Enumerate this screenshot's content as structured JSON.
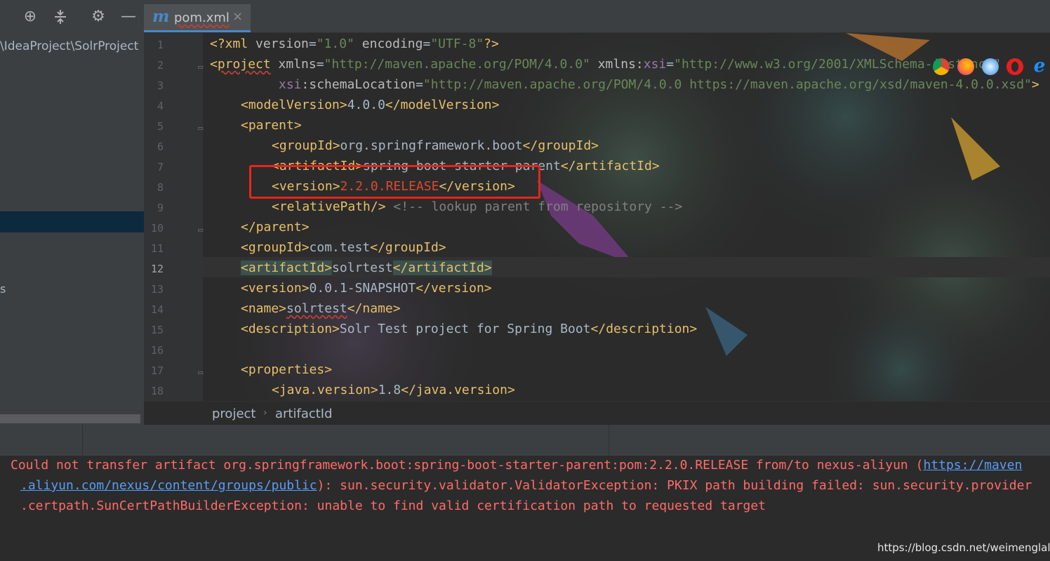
{
  "project_panel": {
    "path": "\\IdeaProject\\SolrProject",
    "tree_fragment": "s",
    "toolbar": [
      "locate-icon",
      "collapse-icon",
      "gear-icon",
      "minimize-icon"
    ]
  },
  "tab": {
    "label": "pom.xml",
    "icon": "m",
    "close": "×"
  },
  "editor": {
    "line_numbers": [
      "1",
      "2",
      "3",
      "4",
      "5",
      "6",
      "7",
      "8",
      "9",
      "10",
      "11",
      "12",
      "13",
      "14",
      "15",
      "16",
      "17",
      "18"
    ],
    "current_line": "12",
    "lines": {
      "l1": {
        "open": "<?xml ",
        "a1": "version",
        "eq1": "=",
        "v1": "\"1.0\"",
        "sp": " ",
        "a2": "encoding",
        "eq2": "=",
        "v2": "\"UTF-8\"",
        "close": "?>"
      },
      "l2": {
        "lt": "<",
        "tag": "project",
        "sp1": " ",
        "a1": "xmlns",
        "eq1": "=",
        "v1": "\"http://maven.apache.org/POM/4.0.0\"",
        "sp2": " ",
        "a2": "xmlns",
        "colon": ":",
        "ns": "xsi",
        "eq2": "=",
        "v2": "\"http://www.w3.org/2001/XMLSchema-instance\""
      },
      "l3": {
        "ns": "xsi",
        "colon": ":",
        "a": "schemaLocation",
        "eq": "=",
        "v": "\"http://maven.apache.org/POM/4.0.0 https://maven.apache.org/xsd/maven-4.0.0.xsd\"",
        "close": ">"
      },
      "l4": {
        "open": "<modelVersion>",
        "text": "4.0.0",
        "close": "</modelVersion>"
      },
      "l5": {
        "open": "<parent>"
      },
      "l6": {
        "open": "<groupId>",
        "text": "org.springframework.boot",
        "close": "</groupId>"
      },
      "l7": {
        "open": "<artifactId>",
        "text": "spring-boot-starter-parent",
        "close": "</artifactId>"
      },
      "l8": {
        "open": "<version>",
        "text": "2.2.0.RELEASE",
        "close": "</version>"
      },
      "l9": {
        "open": "<relativePath/>",
        "sp": " ",
        "comment": "<!-- lookup parent from repository -->"
      },
      "l10": {
        "close": "</parent>"
      },
      "l11": {
        "open": "<groupId>",
        "text": "com.test",
        "close": "</groupId>"
      },
      "l12": {
        "open": "<artifactId>",
        "text": "solrtest",
        "close": "</artifactId>"
      },
      "l13": {
        "open": "<version>",
        "text": "0.0.1-SNAPSHOT",
        "close": "</version>"
      },
      "l14": {
        "open": "<name>",
        "text": "solrtest",
        "close": "</name>"
      },
      "l15": {
        "open": "<description>",
        "text": "Solr Test project for Spring Boot",
        "close": "</description>"
      },
      "l17": {
        "open": "<properties>"
      },
      "l18": {
        "open": "<java.version>",
        "text": "1.8",
        "close": "</java.version>"
      }
    },
    "browser_icons": [
      "chrome-icon",
      "firefox-icon",
      "safari-icon",
      "opera-icon",
      "ie-icon"
    ]
  },
  "breadcrumb": {
    "items": [
      "project",
      "artifactId"
    ],
    "separator": "›"
  },
  "console": {
    "error_part1": "Could not transfer artifact org.springframework.boot:spring-boot-starter-parent:pom:2.2.0.RELEASE from/to nexus-aliyun (",
    "link_part1": "https://maven",
    "link_part2": ".aliyun.com/nexus/content/groups/public",
    "error_part2": "): sun.security.validator.ValidatorException: PKIX path building failed: sun.security.provider",
    "error_part3": ".certpath.SunCertPathBuilderException: unable to find valid certification path to requested target"
  },
  "watermark": "https://blog.csdn.net/weimenglala",
  "colors": {
    "error": "#ff6b68",
    "link": "#589df6",
    "highlight_box": "#e8251a",
    "tab_accent": "#4a88c7"
  }
}
